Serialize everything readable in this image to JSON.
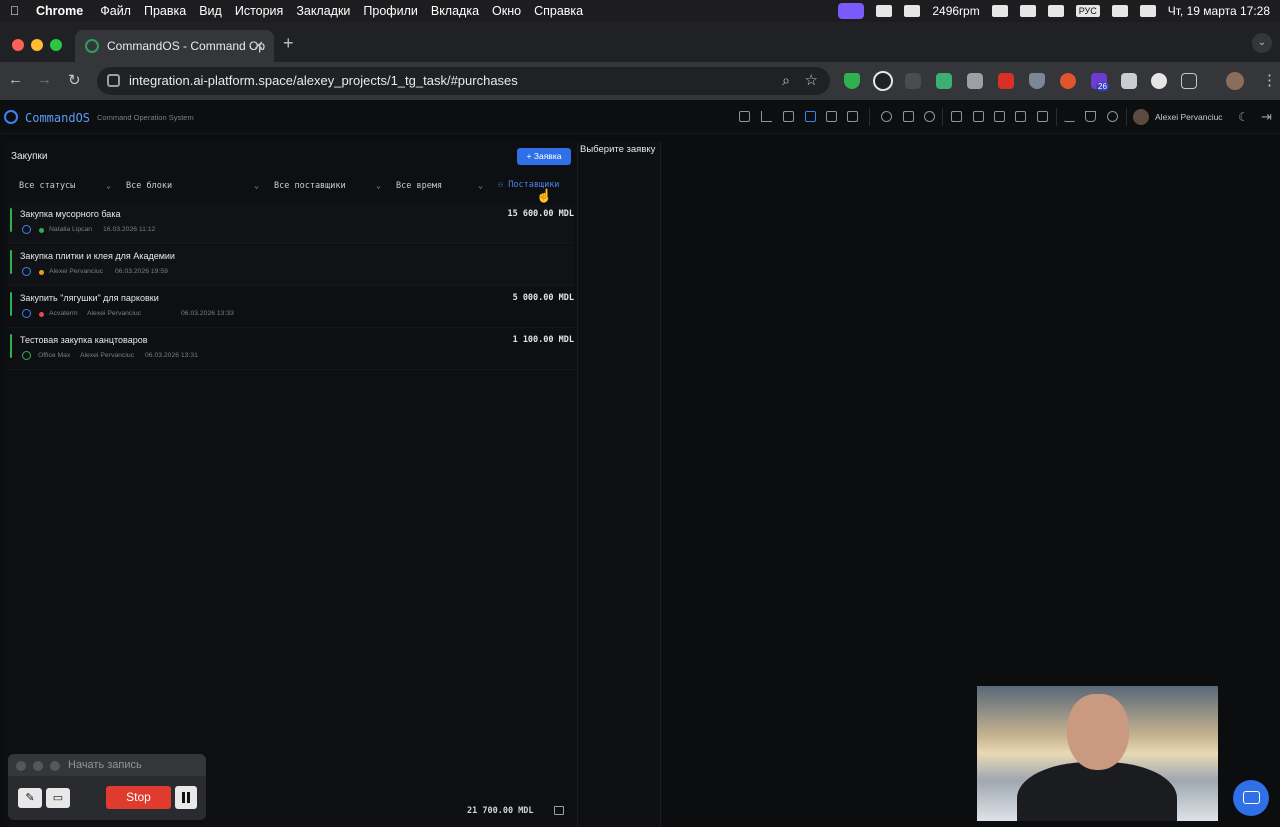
{
  "menubar": {
    "app": "Chrome",
    "items": [
      "Файл",
      "Правка",
      "Вид",
      "История",
      "Закладки",
      "Профили",
      "Вкладка",
      "Окно",
      "Справка"
    ],
    "rpm": "2496rpm",
    "keyboard": "РУС",
    "datetime": "Чт, 19 марта  17:28"
  },
  "browser": {
    "tab_title": "CommandOS - Command Op",
    "url": "integration.ai-platform.space/alexey_projects/1_tg_task/#purchases",
    "ext_badge": "26"
  },
  "app": {
    "brand": "CommandOS",
    "tagline": "Command Operation System",
    "user_name": "Alexei Pervanciuc"
  },
  "purchases": {
    "title": "Закупки",
    "add_label": "+ Заявка",
    "filters": {
      "status": "Все статусы",
      "blocks": "Все блоки",
      "suppliers": "Все поставщики",
      "time": "Все время"
    },
    "suppliers_link": "Поставщики",
    "items": [
      {
        "title": "Закупка мусорного бака",
        "amount": "15 600.00 MDL",
        "supplier": "",
        "person": "Natalia Lipcan",
        "date": "16.03.2026 11:12",
        "dot": "#2fb150",
        "status": "pending"
      },
      {
        "title": "Закупка плитки и клея для Академии",
        "amount": "",
        "supplier": "",
        "person": "Alexei Pervanciuc",
        "date": "06.03.2026 19:59",
        "dot": "#f59e0b",
        "status": "pending"
      },
      {
        "title": "Закупить \"лягушки\" для парковки",
        "amount": "5 000.00 MDL",
        "supplier": "Acvaterm",
        "person": "Alexei Pervanciuc",
        "date": "06.03.2026 13:33",
        "dot": "#e5484d",
        "status": "pending"
      },
      {
        "title": "Тестовая закупка канцтоваров",
        "amount": "1 100.00 MDL",
        "supplier": "Office Max",
        "person": "Alexei Pervanciuc",
        "date": "06.03.2026 13:31",
        "dot": "",
        "status": "done"
      }
    ],
    "total": "21 700.00 MDL"
  },
  "detail": {
    "placeholder": "Выберите заявку"
  },
  "recorder": {
    "title": "Начать запись",
    "stop_label": "Stop"
  }
}
